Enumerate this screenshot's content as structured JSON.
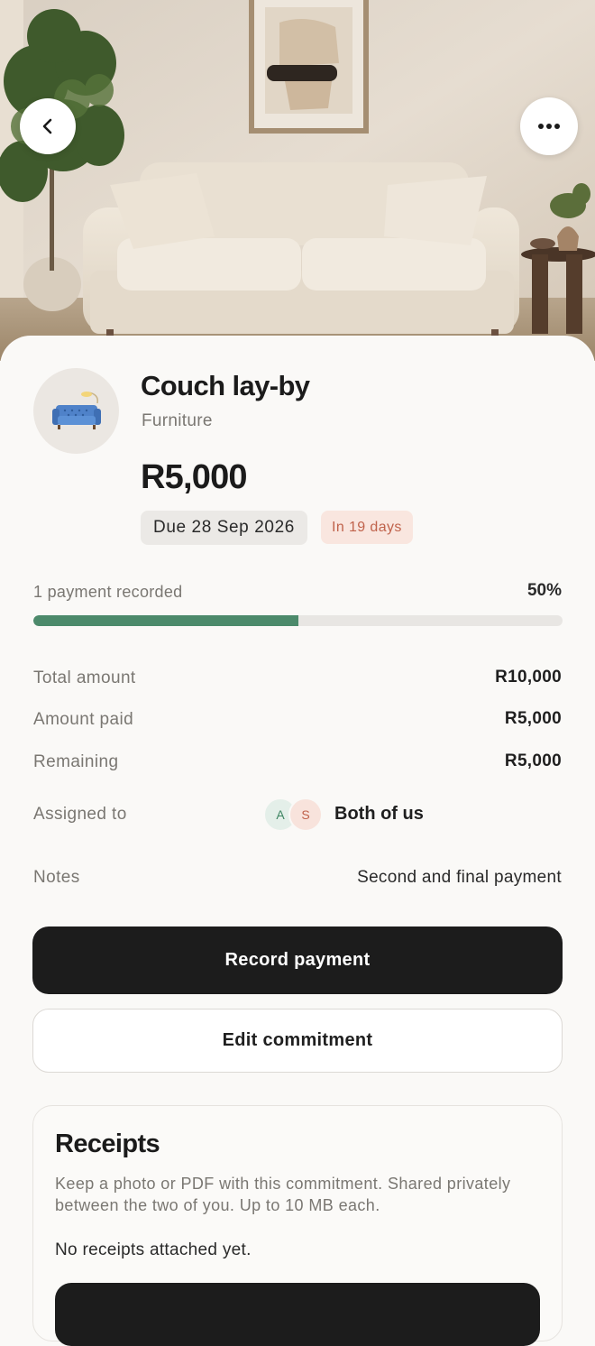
{
  "hero": {
    "image": "beige-couch-living-room-photo",
    "back_icon": "chevron-left-icon",
    "more_icon": "more-horizontal-icon"
  },
  "commitment": {
    "icon": "couch-icon",
    "title": "Couch lay-by",
    "category": "Furniture",
    "amount": "R5,000",
    "due": "Due 28 Sep 2026",
    "due_relative": "In 19 days"
  },
  "progress": {
    "label": "1 payment recorded",
    "percent_label": "50%",
    "fraction": 0.5,
    "fill_color": "#4c8a6b"
  },
  "details": {
    "total_label": "Total amount",
    "total_value": "R10,000",
    "paid_label": "Amount paid",
    "paid_value": "R5,000",
    "remaining_label": "Remaining",
    "remaining_value": "R5,000",
    "assigned_label": "Assigned to",
    "assignee_initials": [
      "A",
      "S"
    ],
    "assignee_name": "Both of us",
    "notes_label": "Notes",
    "notes_value": "Second and final payment"
  },
  "actions": {
    "primary_label": "Record payment",
    "secondary_label": "Edit commitment"
  },
  "receipts": {
    "title": "Receipts",
    "description": "Keep a photo or PDF with this commitment. Shared privately between the two of you. Up to 10 MB each.",
    "empty_text": "No receipts attached yet."
  },
  "colors": {
    "accent_green": "#4c8a6b",
    "warning_text": "#c0634c",
    "primary_button": "#1c1c1c"
  }
}
